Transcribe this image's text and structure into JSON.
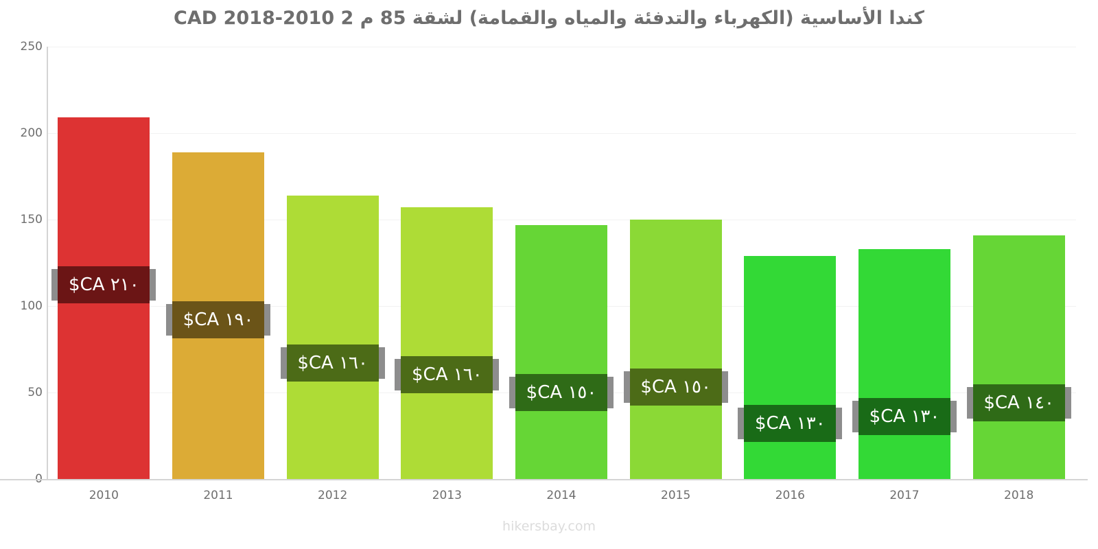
{
  "header": {
    "title": "كندا الأساسية (الكهرباء والتدفئة والمياه والقمامة) لشقة 85 م 2 2010-2018 CAD"
  },
  "footer": {
    "credit": "hikersbay.com"
  },
  "chart_data": {
    "type": "bar",
    "title": "كندا الأساسية (الكهرباء والتدفئة والمياه والقمامة) لشقة 85 م 2 2010-2018 CAD",
    "xlabel": "",
    "ylabel": "",
    "ylim": [
      0,
      250
    ],
    "grid": true,
    "legend": false,
    "currency": "CAD",
    "categories": [
      "2010",
      "2011",
      "2012",
      "2013",
      "2014",
      "2015",
      "2016",
      "2017",
      "2018"
    ],
    "values": [
      209,
      189,
      164,
      157,
      147,
      150,
      129,
      133,
      141
    ],
    "y_ticks": [
      0,
      50,
      100,
      150,
      200,
      250
    ],
    "y_tick_labels": [
      "0",
      "50",
      "100",
      "150",
      "200",
      "250"
    ],
    "data_labels": [
      "٢١٠ CA$",
      "١٩٠ CA$",
      "١٦٠ CA$",
      "١٦٠ CA$",
      "١٥٠ CA$",
      "١٥٠ CA$",
      "١٣٠ CA$",
      "١٣٠ CA$",
      "١٤٠ CA$"
    ],
    "bar_colors": [
      "#dd3333",
      "#dcab36",
      "#aedc36",
      "#aedc36",
      "#66d636",
      "#8bd936",
      "#33d936",
      "#33d936",
      "#66d636"
    ],
    "label_box_colors": [
      "#6b1515",
      "#6b5418",
      "#4c6b17",
      "#4c6b17",
      "#2f6b17",
      "#4c6b17",
      "#196b17",
      "#196b17",
      "#2f6b17"
    ],
    "label_shadow_color": "#8d8d8d",
    "axis_color": "#d4d4d4",
    "grid_color": "#f2f2f2",
    "text_color": "#6e6e6e"
  }
}
